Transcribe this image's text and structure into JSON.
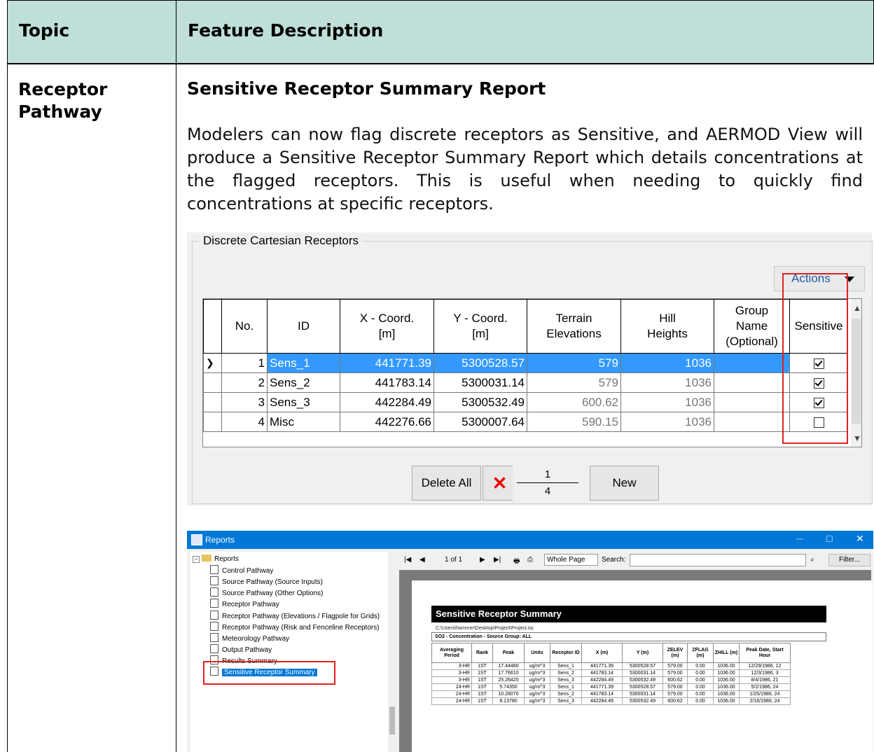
{
  "header": {
    "topic": "Topic",
    "feature": "Feature Description"
  },
  "row": {
    "topic": "Receptor Pathway",
    "heading": "Sensitive Receptor Summary Report",
    "paragraph": "Modelers can now flag discrete receptors as Sensitive, and AERMOD View will produce a Sensitive Receptor Summary Report which details concentrations at the flagged receptors. This is useful when needing to quickly find concentrations at specific receptors."
  },
  "receptors": {
    "group_title": "Discrete Cartesian Receptors",
    "actions_label": "Actions",
    "columns": [
      "No.",
      "ID",
      "X - Coord. [m]",
      "Y - Coord. [m]",
      "Terrain Elevations",
      "Hill Heights",
      "Group Name (Optional)",
      "Sensitive"
    ],
    "rows": [
      {
        "no": "1",
        "id": "Sens_1",
        "x": "441771.39",
        "y": "5300528.57",
        "terrain": "579",
        "hill": "1036",
        "group": "",
        "sensitive": true
      },
      {
        "no": "2",
        "id": "Sens_2",
        "x": "441783.14",
        "y": "5300031.14",
        "terrain": "579",
        "hill": "1036",
        "group": "",
        "sensitive": true
      },
      {
        "no": "3",
        "id": "Sens_3",
        "x": "442284.49",
        "y": "5300532.49",
        "terrain": "600.62",
        "hill": "1036",
        "group": "",
        "sensitive": true
      },
      {
        "no": "4",
        "id": "Misc",
        "x": "442276.66",
        "y": "5300007.64",
        "terrain": "590.15",
        "hill": "1036",
        "group": "",
        "sensitive": false
      }
    ],
    "delete_all_label": "Delete All",
    "new_label": "New",
    "pager": {
      "current": "1",
      "total": "4"
    }
  },
  "reports_window": {
    "title": "Reports",
    "tree_root": "Reports",
    "tree_items": [
      "Control Pathway",
      "Source Pathway (Source Inputs)",
      "Source Pathway (Other Options)",
      "Receptor Pathway",
      "Receptor Pathway (Elevations / Flagpole for Grids)",
      "Receptor Pathway (Risk and Fenceline Receptors)",
      "Meteorology Pathway",
      "Output Pathway",
      "Results Summary",
      "Sensitive Receptor Summary"
    ],
    "toolbar": {
      "page": "1 of 1",
      "zoom": "Whole Page",
      "search_label": "Search:",
      "filter_label": "Filter..."
    },
    "report": {
      "title": "Sensitive Receptor Summary",
      "path": "C:\\Users\\hammer\\Desktop\\Project\\Project.isc",
      "group": "SO2 - Concentration  - Source Group: ALL",
      "columns": [
        "Averaging Period",
        "Rank",
        "Peak",
        "Units",
        "Receptor ID",
        "X (m)",
        "Y (m)",
        "ZELEV (m)",
        "ZFLAG (m)",
        "ZHILL (m)",
        "Peak Date, Start Hour"
      ],
      "rows": [
        [
          "3-HR",
          "1ST",
          "17.44480",
          "ug/m^3",
          "Sens_1",
          "441771.39",
          "5300528.57",
          "579.00",
          "0.00",
          "1036.00",
          "12/29/1986, 12"
        ],
        [
          "3-HR",
          "1ST",
          "17.76610",
          "ug/m^3",
          "Sens_2",
          "441783.14",
          "5300031.14",
          "579.00",
          "0.00",
          "1036.00",
          "12/3/1986, 3"
        ],
        [
          "3-HR",
          "1ST",
          "25.26420",
          "ug/m^3",
          "Sens_3",
          "442284.49",
          "5300532.49",
          "600.62",
          "0.00",
          "1036.00",
          "8/4/1986, 21"
        ],
        [
          "24-HR",
          "1ST",
          "5.74350",
          "ug/m^3",
          "Sens_1",
          "441771.39",
          "5300528.57",
          "579.00",
          "0.00",
          "1036.00",
          "5/2/1986, 24"
        ],
        [
          "24-HR",
          "1ST",
          "10.28070",
          "ug/m^3",
          "Sens_2",
          "441783.14",
          "5300031.14",
          "579.00",
          "0.00",
          "1036.00",
          "1/25/1986, 24"
        ],
        [
          "24-HR",
          "1ST",
          "8.13780",
          "ug/m^3",
          "Sens_3",
          "442284.49",
          "5300532.49",
          "600.62",
          "0.00",
          "1036.00",
          "2/16/1986, 24"
        ]
      ]
    }
  },
  "colors": {
    "header_bg": "#bfdfd8",
    "selection": "#3399ff",
    "highlight_box": "#dd2222",
    "titlebar": "#0078d7"
  }
}
